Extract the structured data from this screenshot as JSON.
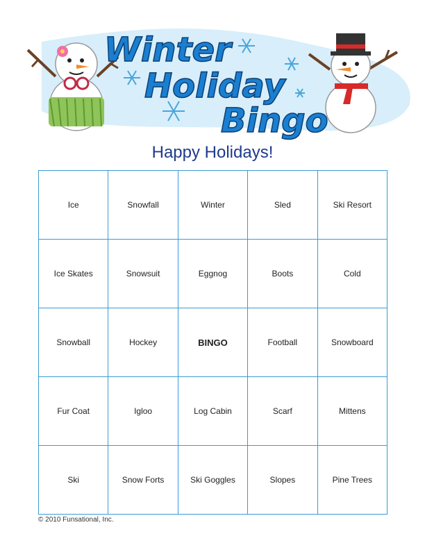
{
  "banner": {
    "title_lines": [
      "Winter",
      "Holiday",
      "Bingo"
    ]
  },
  "subtitle": "Happy Holidays!",
  "card": {
    "rows": [
      [
        "Ice",
        "Snowfall",
        "Winter",
        "Sled",
        "Ski Resort"
      ],
      [
        "Ice Skates",
        "Snowsuit",
        "Eggnog",
        "Boots",
        "Cold"
      ],
      [
        "Snowball",
        "Hockey",
        "BINGO",
        "Football",
        "Snowboard"
      ],
      [
        "Fur Coat",
        "Igloo",
        "Log Cabin",
        "Scarf",
        "Mittens"
      ],
      [
        "Ski",
        "Snow Forts",
        "Ski Goggles",
        "Slopes",
        "Pine Trees"
      ]
    ]
  },
  "footer": {
    "copyright": "© 2010 Funsational, Inc."
  },
  "colors": {
    "title_blue": "#1a7fd1",
    "grid_line": "#3a9bd5",
    "subtitle": "#1f3a8f",
    "snow_band": "#d8eefa"
  }
}
